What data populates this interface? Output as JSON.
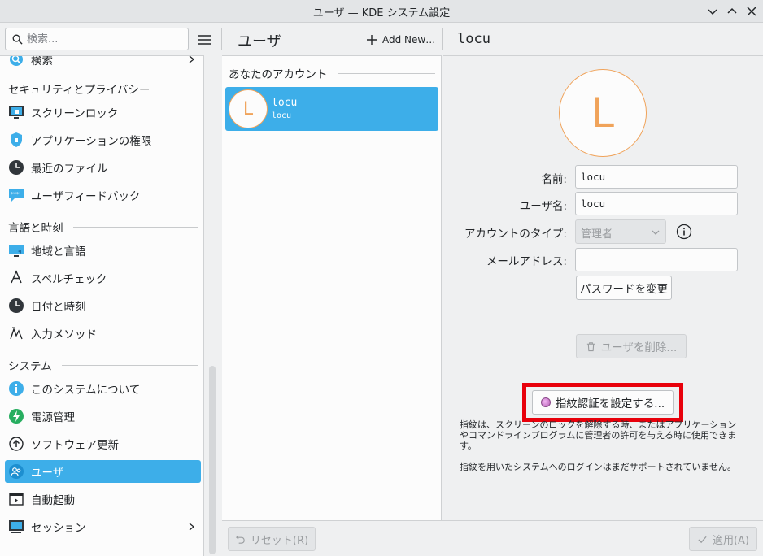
{
  "window": {
    "title": "ユーザ — KDE システム設定",
    "controls": [
      "minimize",
      "maximize",
      "close"
    ]
  },
  "header": {
    "search_placeholder": "検索...",
    "menu_icon": "hamburger-menu-icon",
    "page_title": "ユーザ",
    "add_new_label": "Add New…",
    "detail_title": "locu"
  },
  "sidebar": {
    "top_item": {
      "label": "検索",
      "icon": "search-icon"
    },
    "sections": [
      {
        "title": "セキュリティとプライバシー"
      },
      {
        "title": "言語と時刻"
      },
      {
        "title": "システム"
      }
    ],
    "items": [
      {
        "label": "スクリーンロック",
        "icon": "screen-lock-icon"
      },
      {
        "label": "アプリケーションの権限",
        "icon": "shield-icon"
      },
      {
        "label": "最近のファイル",
        "icon": "clock-icon"
      },
      {
        "label": "ユーザフィードバック",
        "icon": "feedback-icon"
      },
      {
        "label": "地域と言語",
        "icon": "region-icon"
      },
      {
        "label": "スペルチェック",
        "icon": "spellcheck-icon"
      },
      {
        "label": "日付と時刻",
        "icon": "clock-icon"
      },
      {
        "label": "入力メソッド",
        "icon": "input-method-icon"
      },
      {
        "label": "このシステムについて",
        "icon": "info-icon"
      },
      {
        "label": "電源管理",
        "icon": "power-icon"
      },
      {
        "label": "ソフトウェア更新",
        "icon": "update-icon"
      },
      {
        "label": "ユーザ",
        "icon": "users-icon",
        "selected": true
      },
      {
        "label": "自動起動",
        "icon": "autostart-icon"
      },
      {
        "label": "セッション",
        "icon": "session-icon"
      }
    ]
  },
  "userlist": {
    "section_title": "あなたのアカウント",
    "users": [
      {
        "initial": "L",
        "name": "locu",
        "username": "locu",
        "selected": true
      }
    ]
  },
  "detail": {
    "avatar_initial": "L",
    "name_label": "名前:",
    "name_value": "locu",
    "username_label": "ユーザ名:",
    "username_value": "locu",
    "account_type_label": "アカウントのタイプ:",
    "account_type_value": "管理者",
    "email_label": "メールアドレス:",
    "email_value": "",
    "change_password_label": "パスワードを変更",
    "delete_user_label": "ユーザを削除...",
    "fingerprint_label": "指紋認証を設定する...",
    "fingerprint_note_1": "指紋は、スクリーンのロックを解除する時、またはアプリケーションやコマンドラインプログラムに管理者の許可を与える時に使用できます。",
    "fingerprint_note_2": "指紋を用いたシステムへのログインはまだサポートされていません。"
  },
  "footer": {
    "reset_label": "リセット(R)",
    "apply_label": "適用(A)"
  },
  "colors": {
    "accent": "#3daee9",
    "avatar_orange": "#f0a35a",
    "highlight_red": "#e8000b"
  }
}
